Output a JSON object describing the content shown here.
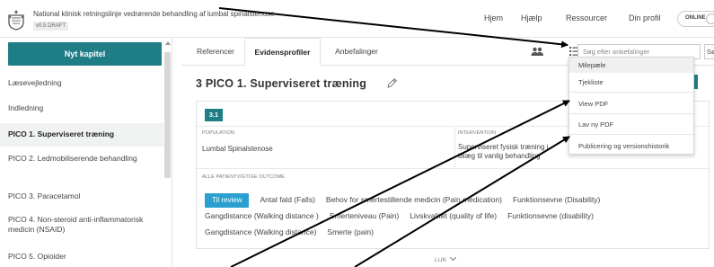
{
  "header": {
    "document_title": "National klinisk retningslinje vedrørende behandling af lumbal spinalstenose",
    "version_badge": "v0.5 DRAFT",
    "nav": [
      "Hjem",
      "Hjælp",
      "Ressourcer",
      "Din profil"
    ],
    "online_label": "ONLINE"
  },
  "sidebar": {
    "new_chapter_label": "Nyt kapitel",
    "items": [
      "Læsevejledning",
      "Indledning",
      "PICO 1. Superviseret træning",
      "PICO 2. Ledmobiliserende behandling",
      "PICO 3. Paracetamol",
      "PICO 4. Non-steroid anti-inflammatorisk medicin (NSAID)",
      "PICO 5. Opioider"
    ],
    "active_index": 2
  },
  "tabs": [
    {
      "label": "Referencer"
    },
    {
      "label": "Evidensprofiler"
    },
    {
      "label": "Anbefalinger"
    }
  ],
  "active_tab": 1,
  "search": {
    "placeholder": "Søg efter anbefalinger",
    "button_label": "Sø"
  },
  "section": {
    "title": "3 PICO 1. Superviseret træning",
    "pico_number": "3.1",
    "population_label": "POPULATION",
    "population_value": "Lumbal Spinalstenose",
    "intervention_label": "INTERVENTION",
    "intervention_value": "Superviseret fysisk træning i tillæg til vanlig behandling",
    "outcomes_label": "ALLE PATIENTVIGTIGE OUTCOME",
    "outcomes_status": "Til review",
    "outcomes": [
      "Antal fald (Falls)",
      "Behov for smertestillende medicin (Pain medication)",
      "Funktionsevne (Disability)",
      "Gangdistance (Walking distance )",
      "Smerteniveau (Pain)",
      "Livskvalitet (quality of life)",
      "Funktionsevne (disability)",
      "Gangdistance (Walking distance)",
      "Smerte (pain)"
    ],
    "collapse_label": "LUK"
  },
  "dropdown": {
    "items": [
      "Milepæle",
      "Tjekliste",
      "View PDF",
      "Lav ny PDF",
      "Publicering og versionshistorik"
    ]
  },
  "colors": {
    "accent_teal": "#1f7d86",
    "review_blue": "#2a9fd0"
  }
}
